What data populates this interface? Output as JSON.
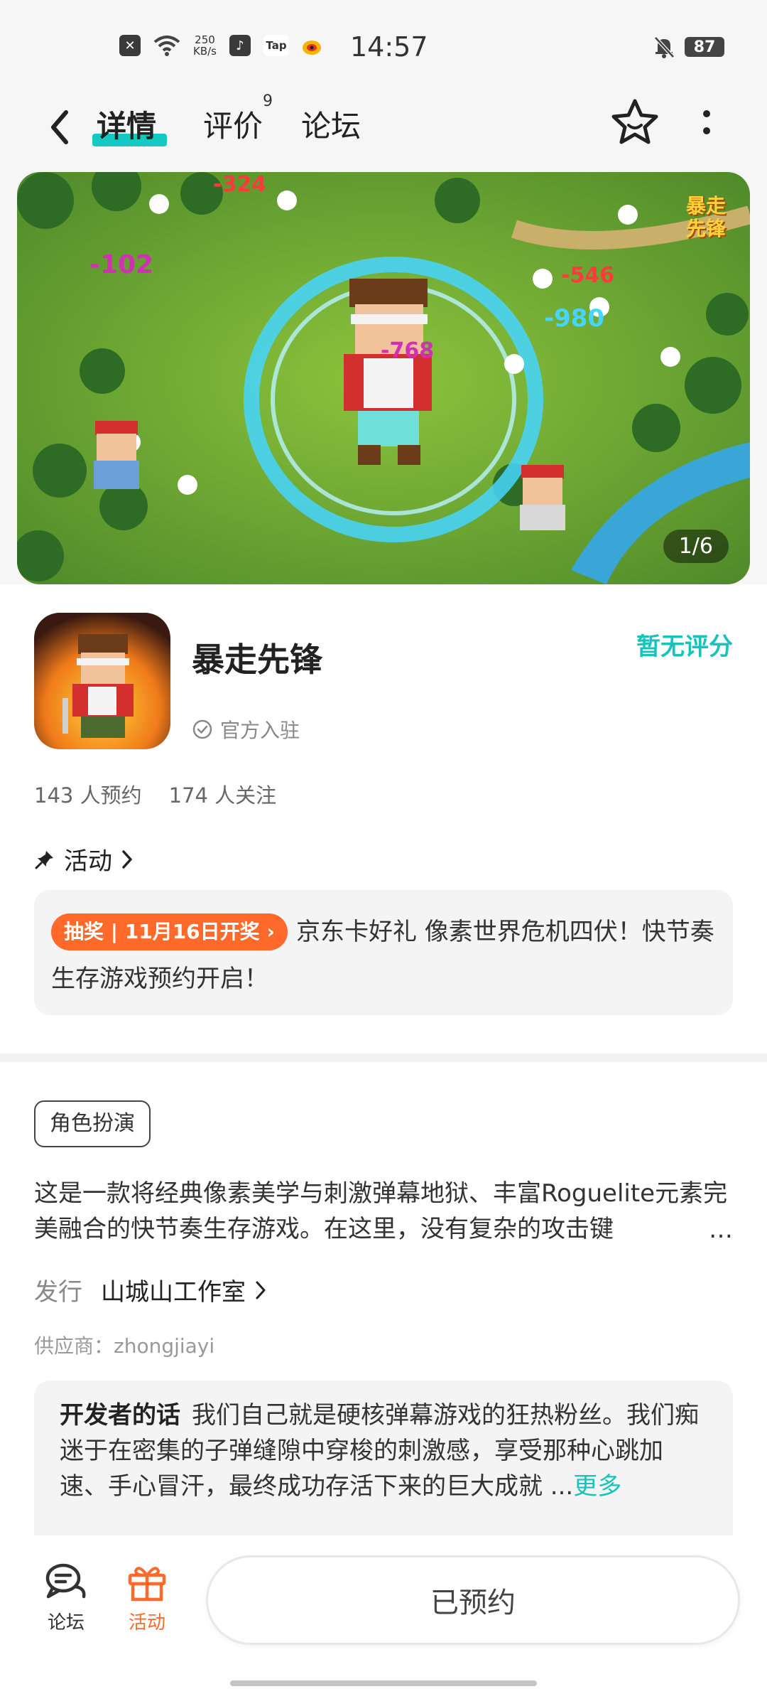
{
  "status_bar": {
    "speed_value": "250",
    "speed_unit": "KB/s",
    "tiktok_icon": "♪",
    "tap_icon": "Tap",
    "time": "14:57",
    "battery": "87"
  },
  "nav": {
    "tabs": [
      {
        "label": "详情"
      },
      {
        "label": "评价",
        "badge": "9"
      },
      {
        "label": "论坛"
      }
    ]
  },
  "banner": {
    "counter": "1/6",
    "logo_line1": "暴走",
    "logo_line2": "先锋",
    "damage_numbers": [
      "-324",
      "-102",
      "-546",
      "-980",
      "-768"
    ]
  },
  "game": {
    "title": "暴走先锋",
    "official": "官方入驻",
    "rating": "暂无评分",
    "reservations": "143 人预约",
    "followers": "174 人关注"
  },
  "activity": {
    "heading": "活动",
    "tag": "抽奖 | 11月16日开奖",
    "text": "京东卡好礼 像素世界危机四伏！快节奏生存游戏预约开启！"
  },
  "description": {
    "genre": "角色扮演",
    "text": "这是一款将经典像素美学与刺激弹幕地狱、丰富Roguelite元素完美融合的快节奏生存游戏。在这里，没有复杂的攻击键",
    "ellipsis": "…",
    "publisher_label": "发行",
    "publisher": "山城山工作室",
    "supplier": "供应商：zhongjiayi"
  },
  "developer": {
    "label": "开发者的话",
    "text": "我们自己就是硬核弹幕游戏的狂热粉丝。我们痴迷于在密集的子弹缝隙中穿梭的刺激感，享受那种心跳加速、手心冒汗，最终成功存活下来的巨大成就 ...",
    "more": "更多"
  },
  "bottom": {
    "forum_label": "论坛",
    "activity_label": "活动",
    "reserve_button": "已预约"
  },
  "colors": {
    "accent": "#14c9c2",
    "activity_orange": "#ff6a2b"
  }
}
